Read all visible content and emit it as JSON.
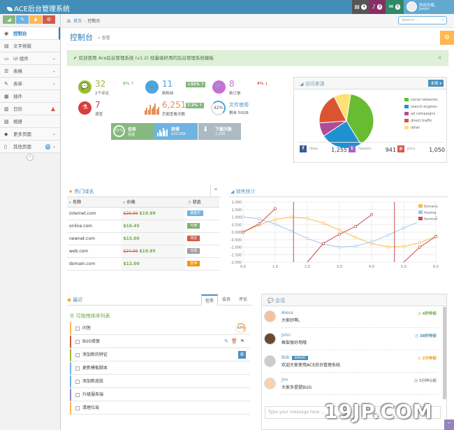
{
  "navbar": {
    "brand": "ACE后台管理系统",
    "badges": [
      {
        "count": "4",
        "color": "#555555",
        "icon": "tasks-icon"
      },
      {
        "count": "8",
        "color": "#a0a0a0",
        "icon": "bell-icon"
      },
      {
        "count": "5",
        "color": "#2e8965",
        "icon": "envelope-icon"
      }
    ],
    "user_welcome": "欢迎光临,",
    "user_name": "Jason"
  },
  "sidebar": {
    "shortcut_colors": [
      "#87b87f",
      "#6fb3e0",
      "#ffb752",
      "#d15b47"
    ],
    "items": [
      {
        "label": "控制台",
        "icon": "dashboard-icon",
        "active": true
      },
      {
        "label": "文字排版",
        "icon": "text-icon"
      },
      {
        "label": "UI 组件",
        "icon": "desktop-icon",
        "chevron": true
      },
      {
        "label": "表格",
        "icon": "list-icon",
        "chevron": true
      },
      {
        "label": "表单",
        "icon": "edit-icon",
        "chevron": true
      },
      {
        "label": "插件",
        "icon": "widget-icon"
      },
      {
        "label": "日历",
        "icon": "calendar-icon",
        "warn": true
      },
      {
        "label": "相册",
        "icon": "picture-icon"
      },
      {
        "label": "更多页面",
        "icon": "tag-icon",
        "chevron": true
      },
      {
        "label": "其他页面",
        "icon": "file-icon",
        "chevron": true,
        "pill": "5"
      }
    ]
  },
  "breadcrumb": {
    "home": "首页",
    "current": "控制台"
  },
  "search": {
    "placeholder": "Search ..."
  },
  "page": {
    "title": "控制台",
    "subtitle": "查看"
  },
  "alert": {
    "prefix": "欢迎使用",
    "brand": "Ace后台管理系统",
    "version": "(v1.2)",
    "suffix": "轻量级好用的后台管理系统模板"
  },
  "infoboxes": [
    {
      "num": "32",
      "label": "2个评论",
      "stat": "8%",
      "dir": "up",
      "color": "#9abc32",
      "icon": "comment-icon"
    },
    {
      "num": "11",
      "label": "新粉丝",
      "stat": "+32%",
      "dir": "upbox",
      "color": "#4fa4db",
      "icon": "twitter-icon"
    },
    {
      "num": "8",
      "label": "新订单",
      "stat": "4%",
      "dir": "down",
      "color": "#cb6fd7",
      "icon": "cart-icon"
    },
    {
      "num": "7",
      "label": "调查",
      "color": "#d53f40",
      "icon": "flask-icon"
    },
    {
      "num": "6,251",
      "label": "页面查看次数",
      "stat": "7.2%",
      "dir": "upbox",
      "color": "#e5905a",
      "icon": "bars-icon"
    },
    {
      "num": "42%",
      "label": "文件使用",
      "label2": "剩余 50GB",
      "color": "#4fa4db",
      "icon": "pie-icon"
    }
  ],
  "tiles": [
    {
      "t1": "任务",
      "t2": "完成",
      "pct": "61%",
      "color": "#87b87f"
    },
    {
      "t1": "获得",
      "t2": "$32,000",
      "color": "#6fb3e0"
    },
    {
      "t1": "下载次数",
      "t2": "1,205",
      "color": "#abbac3"
    }
  ],
  "traffic": {
    "title": "访问来源",
    "dropdown": "本周",
    "legend": [
      {
        "name": "social networks",
        "color": "#68bc31",
        "value": 38.7
      },
      {
        "name": "search engines",
        "color": "#2091cf",
        "value": 24.5
      },
      {
        "name": "ad campaigns",
        "color": "#af4e96",
        "value": 8.2
      },
      {
        "name": "direct traffic",
        "color": "#da5430",
        "value": 18.6
      },
      {
        "name": "other",
        "color": "#fee074",
        "value": 10
      }
    ],
    "social": [
      {
        "name": "likes",
        "value": "1,255",
        "color": "#3b5998",
        "icon": "facebook-icon"
      },
      {
        "name": "tweets",
        "value": "941",
        "color": "#a068c4",
        "icon": "twitter-icon"
      },
      {
        "name": "pins",
        "value": "1,050",
        "color": "#d15b47",
        "icon": "pinterest-icon"
      }
    ]
  },
  "domains": {
    "title": "热门域名",
    "headers": [
      "名称",
      "价格",
      "状态"
    ],
    "rows": [
      {
        "name": "internet.com",
        "old": "$29.99",
        "price": "$19.99",
        "status": "销售中",
        "color": "#6fb3e0"
      },
      {
        "name": "online.com",
        "old": "",
        "price": "$16.45",
        "status": "可用",
        "color": "#82af6f"
      },
      {
        "name": "newnet.com",
        "old": "",
        "price": "$15.00",
        "status": "待定",
        "color": "#d15b47"
      },
      {
        "name": "web.com",
        "old": "$24.99",
        "price": "$19.95",
        "status": "无效",
        "color": "#a0a0a0"
      },
      {
        "name": "domain.com",
        "old": "",
        "price": "$12.00",
        "status": "暂停",
        "color": "#f89406"
      }
    ]
  },
  "chart_data": {
    "type": "line",
    "title": "销售统计",
    "xlim": [
      0,
      6
    ],
    "ylim": [
      -2,
      2
    ],
    "xticks": [
      "0.0",
      "1.0",
      "2.0",
      "3.0",
      "4.0",
      "5.0",
      "6.0"
    ],
    "yticks": [
      "2.000",
      "1.500",
      "1.000",
      "0.500",
      "0.000",
      "-0.500",
      "-1.000",
      "-1.500",
      "-2.000"
    ],
    "series": [
      {
        "name": "Domains",
        "color": "#f2bd53",
        "func": "sin"
      },
      {
        "name": "Hosting",
        "color": "#9fc6ee",
        "func": "cos"
      },
      {
        "name": "Services",
        "color": "#cb4b4b",
        "func": "tan"
      }
    ]
  },
  "recent": {
    "title": "最近",
    "tabs": [
      "任务",
      "会员",
      "评论"
    ],
    "subtitle": "可拖拽排序列表",
    "tasks": [
      {
        "label": "问答",
        "color": "#ffb752",
        "extra": "42%"
      },
      {
        "label": "BUG修复",
        "color": "#d15b47",
        "extra": "icons"
      },
      {
        "label": "添加新的特征",
        "color": "#9abc32",
        "extra": "gear"
      },
      {
        "label": "更新模板脚本",
        "color": "#6fb3e0"
      },
      {
        "label": "添加新皮肤",
        "color": "#6fb3e0"
      },
      {
        "label": "升级服务端",
        "color": "#9585bf"
      },
      {
        "label": "清理垃圾",
        "color": "#ffb752"
      }
    ]
  },
  "chat": {
    "title": "会话",
    "placeholder": "Type your message here ...",
    "messages": [
      {
        "name": "Alexa",
        "time": "4秒钟前",
        "msg": "大家好啊。",
        "tc": "green"
      },
      {
        "name": "John",
        "time": "38秒钟前",
        "msg": "框架很好用哦",
        "tc": "blue"
      },
      {
        "name": "Bob",
        "tag": "admin",
        "time": "2分钟前",
        "msg": "欢迎大家使用ACE后台管理系统.",
        "tc": "orange"
      },
      {
        "name": "Jim",
        "time": "3分钟以前",
        "msg": "大家多提提BUG",
        "tc": "gray"
      }
    ]
  },
  "watermark": "19JP.COM"
}
